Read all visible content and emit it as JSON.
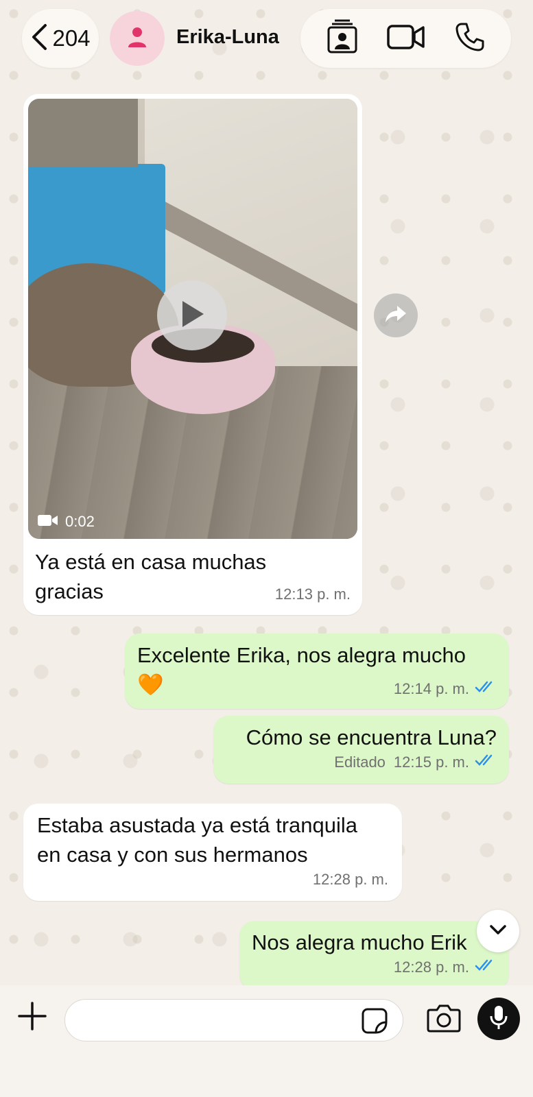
{
  "header": {
    "back_count": "204",
    "contact_name": "Erika-Luna"
  },
  "icons": {
    "back": "chevron-left-icon",
    "avatar": "person-icon",
    "contact_card": "contact-card-icon",
    "video_call": "video-camera-icon",
    "voice_call": "phone-icon",
    "play": "play-icon",
    "forward": "forward-icon",
    "scroll_down": "chevron-down-icon",
    "attach": "plus-icon",
    "sticker": "sticker-icon",
    "camera": "camera-icon",
    "mic": "microphone-icon",
    "read_receipt": "double-check-icon"
  },
  "colors": {
    "incoming_bubble": "#ffffff",
    "outgoing_bubble": "#dcf8c9",
    "read_tick": "#2c8fe8",
    "avatar_bg": "#f7d4dc",
    "avatar_fg": "#e0346b"
  },
  "messages": [
    {
      "direction": "incoming",
      "type": "video",
      "duration": "0:02",
      "text": "Ya está en casa muchas gracias",
      "time": "12:13 p. m."
    },
    {
      "direction": "outgoing",
      "text": "Excelente Erika, nos alegra mucho 🧡",
      "time": "12:14 p. m.",
      "status": "read"
    },
    {
      "direction": "outgoing",
      "text": "Cómo se encuentra Luna?",
      "edited_label": "Editado",
      "time": "12:15 p. m.",
      "status": "read"
    },
    {
      "direction": "incoming",
      "text": "Estaba asustada ya está tranquila en casa y con sus hermanos",
      "time": "12:28 p. m."
    },
    {
      "direction": "outgoing",
      "text": "Nos alegra mucho Erik",
      "time": "12:28 p. m.",
      "status": "read"
    }
  ],
  "composer": {
    "placeholder": ""
  }
}
